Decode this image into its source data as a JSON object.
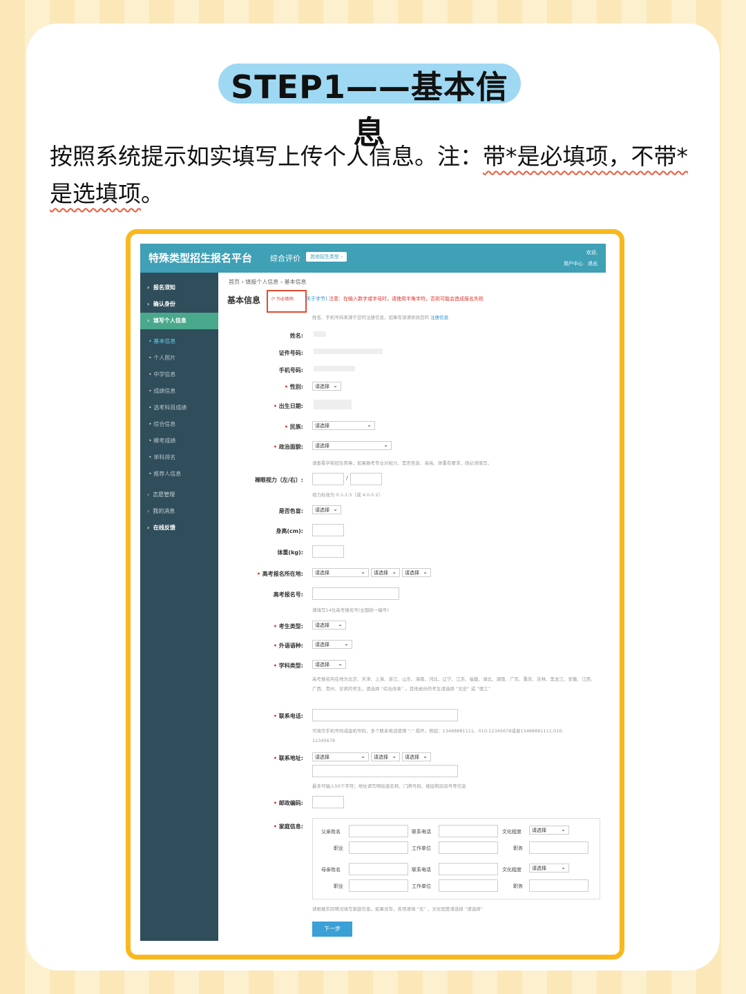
{
  "title": "STEP1——基本信息",
  "intro": {
    "part1": "按照系统提示如实填写上传个人信息。注：",
    "highlight": "带*是必填项，不带*是选填项",
    "end": "。"
  },
  "app": {
    "brand": "特殊类型招生报名平台",
    "nav": "综合评价",
    "badge": "其他招生类型 ›",
    "welcome": "欢迎,",
    "user_center": "用户中心",
    "logout": "退出"
  },
  "sidebar": {
    "top": [
      "报名须知",
      "确认身份",
      "填写个人信息"
    ],
    "sub": [
      "基本信息",
      "个人照片",
      "中学信息",
      "成绩信息",
      "选考科目成绩",
      "综合信息",
      "模考成绩",
      "单科排名",
      "推荐人信息"
    ],
    "bottom": [
      "志愿管理",
      "我的消息",
      "在线反馈"
    ]
  },
  "breadcrumb": "首页 › 填报个人信息 › 基本信息",
  "page_heading": "基本信息",
  "req_note": "(* 为必填项;",
  "notice_link": "关于字节)",
  "notice": "注意：在输入数字或字母时，请使用半角字符，否则可能会造成报名失败",
  "form": {
    "hint_top": "姓名、手机号码来源于您的注册信息，如果有误请修改您的",
    "hint_top_link": "注册信息",
    "name": "姓名:",
    "id": "证件号码:",
    "phone": "手机号码:",
    "gender": "性别:",
    "birth": "出生日期:",
    "ethnic": "民族:",
    "political": "政治面貌:",
    "eye_hint": "请查看学校招生简章，如果报考专业对视力、是否色盲、身高、体重有要求，则必须填写。",
    "vision": "裸眼视力（左/右）:",
    "vision_hint": "视力标准为 0.1-1.5（或 4.0-5.2）",
    "colorblind": "是否色盲:",
    "height": "身高(cm):",
    "weight": "体重(kg):",
    "exam_loc": "高考报名所在地:",
    "exam_no": "高考报名号:",
    "exam_no_hint": "请填写14位高考报名号(全国统一编号)",
    "type": "考生类型:",
    "language": "外语语种:",
    "subject": "学科类型:",
    "subject_hint": "高考报名所在地为北京、天津、上海、浙江、山东、海南、河北、辽宁、江苏、福建、湖北、湖南、广东、重庆、吉林、黑龙江、安徽、江西、广西、贵州、甘肃的考生，请选择 “综合改革” 。其他省份的考生请选择 “文史” 或 “理工”",
    "tel": "联系电话:",
    "tel_hint": "可填写手机号码或座机号码，多个联系电话使用 “;” 隔开。例如：13488881111、010-12345678或者13488881111;010-12345678",
    "address": "联系地址:",
    "address_hint": "最多可输入50个字符；地址请写明街道名称、门牌号码、楼层和房间号等信息",
    "zip": "邮政编码:",
    "family": "家庭信息:",
    "family_hint": "请根据实际情况填写家庭信息。如果没有，各项请填 “无” ，文化程度请选择 “请选择”",
    "placeholder": "请选择",
    "f_father": "父亲姓名",
    "f_mother": "母亲姓名",
    "f_tel": "联系电话",
    "f_edu": "文化程度",
    "f_job": "职业",
    "f_work": "工作单位",
    "f_post": "职务",
    "next": "下一步"
  }
}
